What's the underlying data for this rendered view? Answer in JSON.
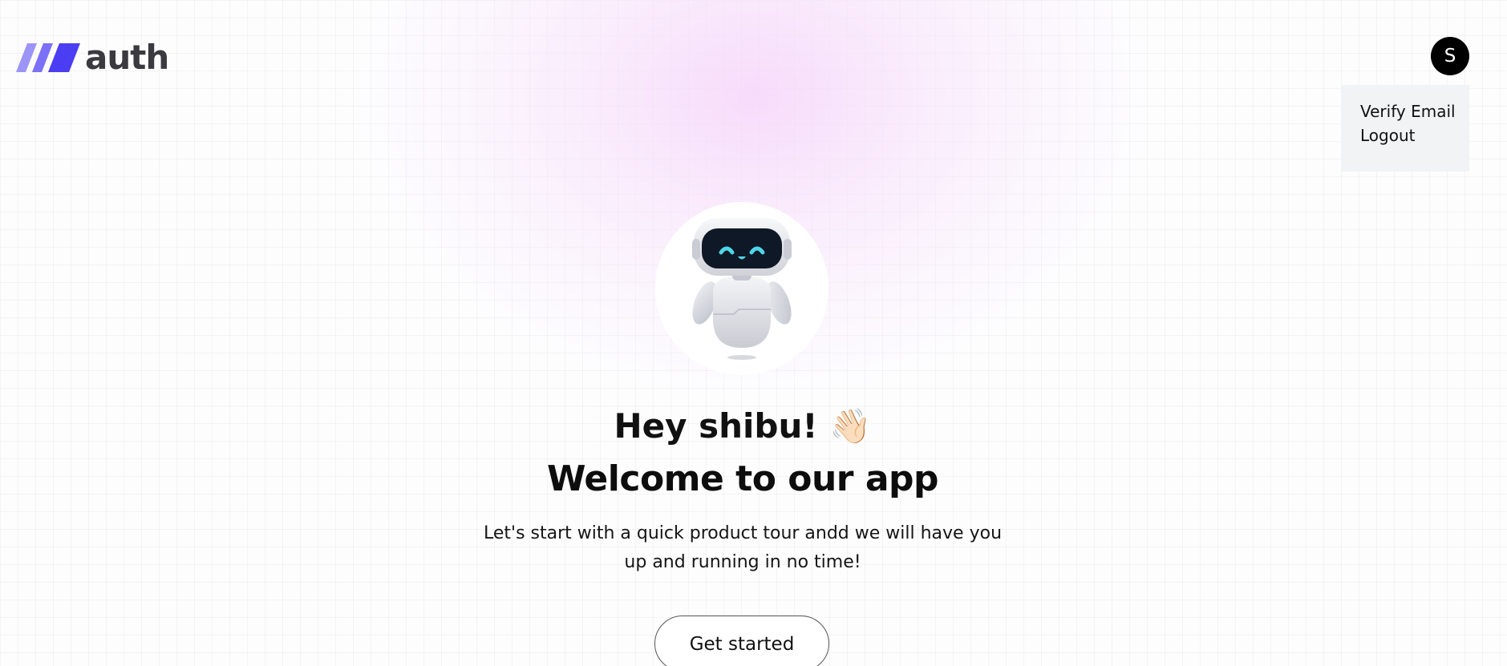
{
  "header": {
    "logo_text": "auth",
    "avatar_initial": "S"
  },
  "user_menu": {
    "items": [
      {
        "label": "Verify Email"
      },
      {
        "label": "Logout"
      }
    ]
  },
  "hero": {
    "greeting": "Hey shibu!",
    "greeting_emoji": "👋🏻",
    "title": "Welcome to our app",
    "description": "Let's start with a quick product tour andd we will have you up and running in no time!",
    "cta_label": "Get started",
    "illustration": "robot-icon"
  },
  "colors": {
    "logo_accent": "#5b4ff5",
    "avatar_bg": "#000000",
    "menu_bg": "#f2f3f5"
  }
}
